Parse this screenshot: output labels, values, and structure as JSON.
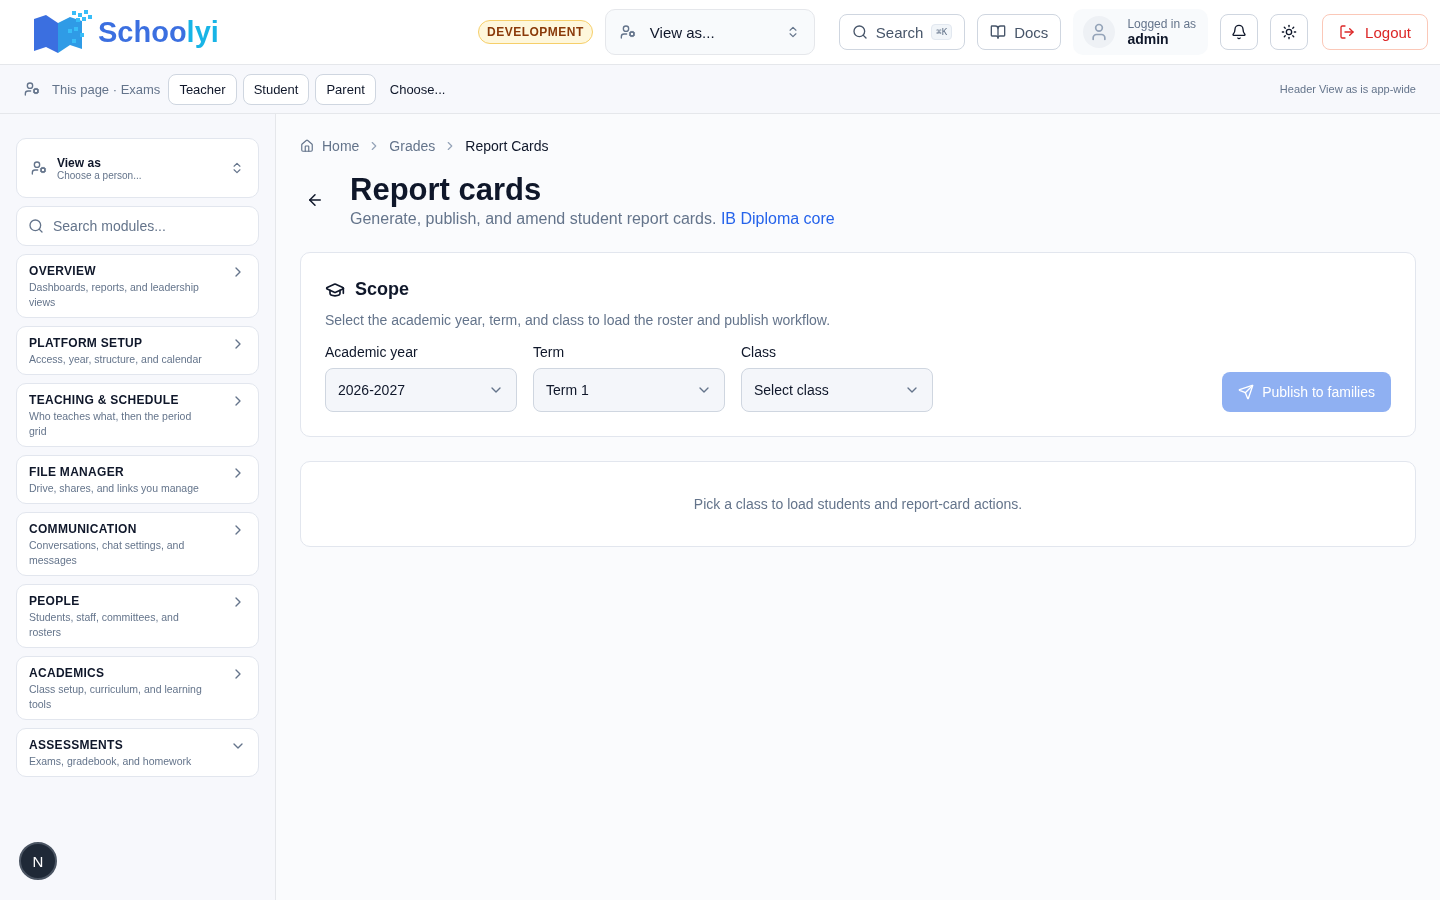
{
  "header": {
    "logo": "Schoolyi",
    "env_badge": "DEVELOPMENT",
    "view_as": "View as...",
    "search": {
      "label": "Search",
      "shortcut": "⌘K"
    },
    "docs": "Docs",
    "user": {
      "caption": "Logged in as",
      "name": "admin"
    },
    "logout": "Logout"
  },
  "view_bar": {
    "label": "This page · Exams",
    "roles": [
      {
        "label": "Teacher",
        "kind": "chip"
      },
      {
        "label": "Student",
        "kind": "chip"
      },
      {
        "label": "Parent",
        "kind": "chip"
      },
      {
        "label": "Choose...",
        "kind": "plain"
      }
    ],
    "note": "Header View as is app-wide"
  },
  "sidebar": {
    "view_as": {
      "title": "View as",
      "subtitle": "Choose a person..."
    },
    "search": {
      "placeholder": "Search modules..."
    },
    "items": [
      {
        "title": "OVERVIEW",
        "description": "Dashboards, reports, and leadership views",
        "expanded": false
      },
      {
        "title": "PLATFORM SETUP",
        "description": "Access, year, structure, and calendar",
        "expanded": false
      },
      {
        "title": "TEACHING & SCHEDULE",
        "description": "Who teaches what, then the period grid",
        "expanded": false
      },
      {
        "title": "FILE MANAGER",
        "description": "Drive, shares, and links you manage",
        "expanded": false
      },
      {
        "title": "COMMUNICATION",
        "description": "Conversations, chat settings, and messages",
        "expanded": false
      },
      {
        "title": "PEOPLE",
        "description": "Students, staff, committees, and rosters",
        "expanded": false
      },
      {
        "title": "ACADEMICS",
        "description": "Class setup, curriculum, and learning tools",
        "expanded": false
      },
      {
        "title": "ASSESSMENTS",
        "description": "Exams, gradebook, and homework",
        "expanded": true
      }
    ],
    "badge": "N"
  },
  "breadcrumbs": [
    "Home",
    "Grades",
    "Report Cards"
  ],
  "page": {
    "title": "Report cards",
    "subtitle": "Generate, publish, and amend student report cards.",
    "subtitle_link": "IB Diploma core"
  },
  "scope": {
    "title": "Scope",
    "description": "Select the academic year, term, and class to load the roster and publish workflow.",
    "fields": [
      {
        "label": "Academic year",
        "value": "2026-2027"
      },
      {
        "label": "Term",
        "value": "Term 1"
      },
      {
        "label": "Class",
        "value": "Select class"
      }
    ],
    "publish": {
      "label": "Publish to families",
      "disabled": true
    }
  },
  "empty_message": "Pick a class to load students and report-card actions."
}
